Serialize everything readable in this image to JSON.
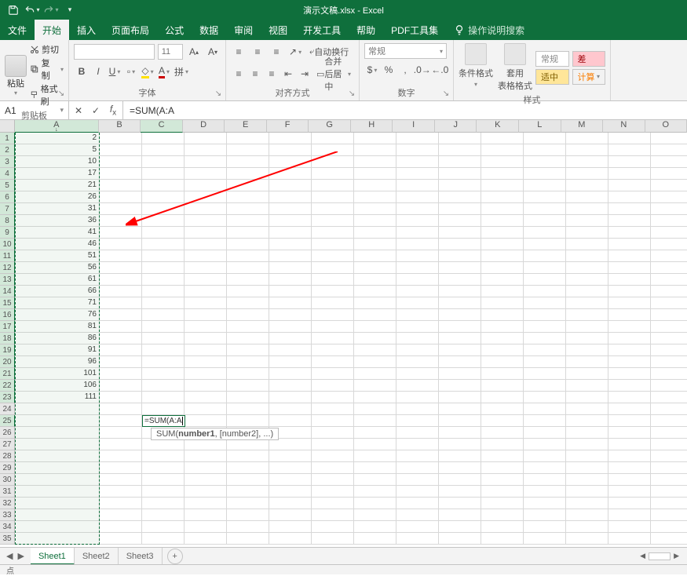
{
  "title": "演示文稿.xlsx - Excel",
  "qat": {
    "save": "save-icon",
    "undo": "undo-icon",
    "redo": "redo-icon"
  },
  "tabs": [
    "文件",
    "开始",
    "插入",
    "页面布局",
    "公式",
    "数据",
    "审阅",
    "视图",
    "开发工具",
    "帮助",
    "PDF工具集"
  ],
  "active_tab_index": 1,
  "tellme": "操作说明搜索",
  "ribbon": {
    "clipboard": {
      "paste": "粘贴",
      "cut": "剪切",
      "copy": "复制",
      "format": "格式刷",
      "label": "剪贴板"
    },
    "font": {
      "name": "",
      "size": "11",
      "label": "字体"
    },
    "alignment": {
      "wrap": "自动换行",
      "merge": "合并后居中",
      "label": "对齐方式"
    },
    "number": {
      "format": "常规",
      "label": "数字"
    },
    "styles": {
      "cond": "条件格式",
      "table": "套用\n表格格式",
      "normal": "常规",
      "good": "适中",
      "bad": "差",
      "calc": "计算",
      "label": "样式"
    }
  },
  "formula_bar": {
    "name_box": "A1",
    "formula": "=SUM(A:A"
  },
  "columns": [
    "A",
    "B",
    "C",
    "D",
    "E",
    "F",
    "G",
    "H",
    "I",
    "J",
    "K",
    "L",
    "M",
    "N",
    "O"
  ],
  "rows": [
    1,
    2,
    3,
    4,
    5,
    6,
    7,
    8,
    9,
    10,
    11,
    12,
    13,
    14,
    15,
    16,
    17,
    18,
    19,
    20,
    21,
    22,
    23,
    24,
    25,
    26,
    27,
    28,
    29,
    30,
    31,
    32,
    33,
    34,
    35
  ],
  "selected_range_col": "A",
  "active_cell_row": 25,
  "col_a_values": [
    "2",
    "5",
    "10",
    "17",
    "21",
    "26",
    "31",
    "36",
    "41",
    "46",
    "51",
    "56",
    "61",
    "66",
    "71",
    "76",
    "81",
    "86",
    "91",
    "96",
    "101",
    "106",
    "111"
  ],
  "active_cell_text": "=SUM(A:A",
  "tooltip_text": {
    "fn": "SUM(",
    "arg1": "number1",
    "rest": ", [number2], ...)"
  },
  "sheets": [
    "Sheet1",
    "Sheet2",
    "Sheet3"
  ],
  "active_sheet_index": 0,
  "status": {
    "mode": "点"
  }
}
